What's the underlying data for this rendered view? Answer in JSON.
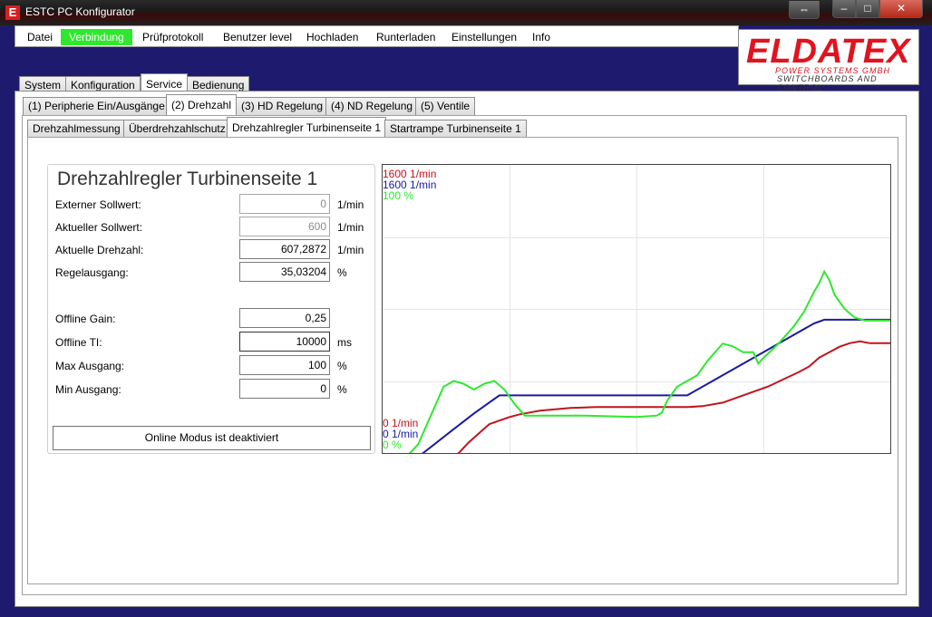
{
  "window": {
    "title": "ESTC PC Konfigurator",
    "app_icon_letter": "E",
    "buttons": {
      "resize": "⇔",
      "minimize": "–",
      "maximize": "□",
      "close": "✕"
    }
  },
  "menu": {
    "items": [
      "Datei",
      "Verbindung",
      "Prüfprotokoll",
      "Benutzer level",
      "Hochladen",
      "Runterladen",
      "Einstellungen",
      "Info"
    ],
    "active_color": "#2ee82e"
  },
  "logo": {
    "brand": "ELDATEX",
    "line1": "POWER SYSTEMS GMBH",
    "line2": "SWITCHBOARDS AND CONTROL",
    "color": "#e0141e"
  },
  "tabs_level1": [
    "System",
    "Konfiguration",
    "Service",
    "Bedienung"
  ],
  "tabs_level2": [
    "(1) Peripherie Ein/Ausgänge",
    "(2) Drehzahl",
    "(3) HD Regelung",
    "(4) ND Regelung",
    "(5) Ventile"
  ],
  "tabs_level3": [
    "Drehzahlmessung",
    "Überdrehzahlschutz",
    "Drehzahlregler Turbinenseite 1",
    "Startrampe Turbinenseite 1"
  ],
  "form": {
    "title": "Drehzahlregler Turbinenseite 1",
    "rows": [
      {
        "label": "Externer Sollwert:",
        "value": "0",
        "unit": "1/min",
        "readonly": true
      },
      {
        "label": "Aktueller Sollwert:",
        "value": "600",
        "unit": "1/min",
        "readonly": true
      },
      {
        "label": "Aktuelle Drehzahl:",
        "value": "607,2872",
        "unit": "1/min",
        "readonly": false
      },
      {
        "label": "Regelausgang:",
        "value": "35,03204",
        "unit": "%",
        "readonly": false
      },
      {
        "label": "Offline Gain:",
        "value": "0,25",
        "unit": "",
        "readonly": false
      },
      {
        "label": "Offline TI:",
        "value": "10000",
        "unit": "ms",
        "readonly": false
      },
      {
        "label": "Max Ausgang:",
        "value": "100",
        "unit": "%",
        "readonly": false
      },
      {
        "label": "Min Ausgang:",
        "value": "0",
        "unit": "%",
        "readonly": false
      }
    ],
    "online_button": "Online Modus ist deaktiviert"
  },
  "chart": {
    "top_labels": [
      "1600 1/min",
      "1600 1/min",
      "100 %"
    ],
    "bottom_labels": [
      "0 1/min",
      "0 1/min",
      "0 %"
    ],
    "colors": [
      "#c0141e",
      "#1a1aa0",
      "#2ee82e"
    ]
  },
  "chart_data": {
    "type": "line",
    "grid": true,
    "series": [
      {
        "y_range": [
          0,
          1600
        ],
        "color": "#c0141e",
        "points": [
          [
            0,
            -150
          ],
          [
            13,
            -40
          ],
          [
            15,
            0
          ],
          [
            17,
            60
          ],
          [
            19,
            110
          ],
          [
            21,
            160
          ],
          [
            23,
            180
          ],
          [
            25,
            200
          ],
          [
            27,
            215
          ],
          [
            29,
            225
          ],
          [
            31,
            235
          ],
          [
            33,
            240
          ],
          [
            37,
            250
          ],
          [
            42,
            255
          ],
          [
            55,
            255
          ],
          [
            60,
            255
          ],
          [
            63,
            260
          ],
          [
            67,
            280
          ],
          [
            70,
            310
          ],
          [
            73,
            340
          ],
          [
            76,
            370
          ],
          [
            79,
            410
          ],
          [
            82,
            450
          ],
          [
            84,
            480
          ],
          [
            86,
            530
          ],
          [
            88,
            560
          ],
          [
            90,
            590
          ],
          [
            92,
            610
          ],
          [
            94,
            620
          ],
          [
            96,
            610
          ],
          [
            100,
            610
          ]
        ]
      },
      {
        "y_range": [
          0,
          1600
        ],
        "color": "#1a1aa0",
        "points": [
          [
            0,
            -150
          ],
          [
            8,
            0
          ],
          [
            13,
            110
          ],
          [
            18,
            220
          ],
          [
            23,
            320
          ],
          [
            25,
            320
          ],
          [
            55,
            320
          ],
          [
            60,
            320
          ],
          [
            65,
            400
          ],
          [
            70,
            480
          ],
          [
            75,
            560
          ],
          [
            80,
            640
          ],
          [
            85,
            720
          ],
          [
            87,
            740
          ],
          [
            90,
            740
          ],
          [
            93,
            740
          ],
          [
            96,
            740
          ],
          [
            100,
            740
          ]
        ]
      },
      {
        "y_range": [
          0,
          100
        ],
        "color": "#2ee82e",
        "points": [
          [
            0,
            -10
          ],
          [
            7,
            3
          ],
          [
            10,
            15
          ],
          [
            12,
            23
          ],
          [
            14,
            25
          ],
          [
            16,
            24
          ],
          [
            18,
            22
          ],
          [
            20,
            24
          ],
          [
            22,
            25
          ],
          [
            24,
            22
          ],
          [
            26,
            17
          ],
          [
            28,
            13
          ],
          [
            30,
            13
          ],
          [
            33,
            13
          ],
          [
            40,
            13
          ],
          [
            50,
            12.5
          ],
          [
            54,
            13
          ],
          [
            55,
            14
          ],
          [
            56,
            18
          ],
          [
            58,
            23
          ],
          [
            60,
            25
          ],
          [
            62,
            27
          ],
          [
            64,
            32
          ],
          [
            66,
            36
          ],
          [
            67,
            38
          ],
          [
            69,
            37
          ],
          [
            71,
            35
          ],
          [
            73,
            35
          ],
          [
            74,
            31
          ],
          [
            75,
            33
          ],
          [
            78,
            38
          ],
          [
            81,
            44
          ],
          [
            83,
            49
          ],
          [
            85,
            56
          ],
          [
            86,
            59
          ],
          [
            87,
            63
          ],
          [
            88,
            60
          ],
          [
            89,
            55
          ],
          [
            91,
            50
          ],
          [
            93,
            47
          ],
          [
            95,
            46
          ],
          [
            100,
            46
          ]
        ]
      }
    ]
  }
}
